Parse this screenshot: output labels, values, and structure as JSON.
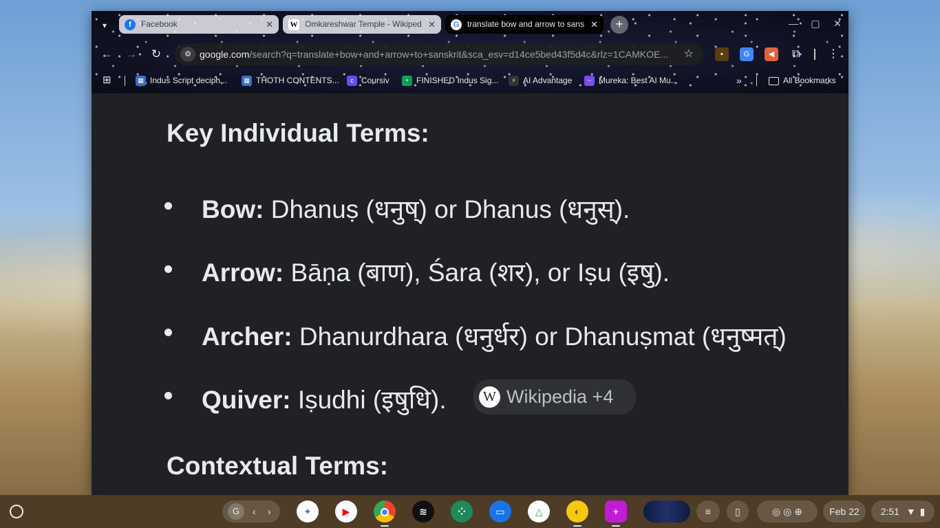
{
  "tabs": [
    {
      "title": "Facebook",
      "favicon": "facebook-icon",
      "active": false
    },
    {
      "title": "Omkareshwar Temple - Wikipedia",
      "favicon": "wikipedia-icon",
      "active": false
    },
    {
      "title": "translate bow and arrow to sanskrit",
      "favicon": "google-icon",
      "active": true
    }
  ],
  "toolbar": {
    "url_domain": "google.com",
    "url_path": "/search?q=translate+bow+and+arrow+to+sanskrit&sca_esv=d14ce5bed43f5d4c&rlz=1CAMKOE..."
  },
  "bookmarks": [
    {
      "label": "Indus Script deciph...",
      "icon": "sheets-grid-icon"
    },
    {
      "label": "THOTH CONTENTS...",
      "icon": "sheets-grid-icon"
    },
    {
      "label": "Coursiv",
      "icon": "coursiv-icon"
    },
    {
      "label": "FINISHED Indus Sig...",
      "icon": "sheets-plus-icon"
    },
    {
      "label": "AI Advantage",
      "icon": "ai-advantage-icon"
    },
    {
      "label": "Mureka: Best AI Mu...",
      "icon": "mureka-icon"
    }
  ],
  "all_bookmarks_label": "All Bookmarks",
  "content": {
    "heading1": "Key Individual Terms:",
    "items": [
      {
        "term": "Bow:",
        "text": " Dhanuṣ (धनुष्) or Dhanus (धनुस्)."
      },
      {
        "term": "Arrow:",
        "text": " Bāṇa (बाण), Śara (शर), or Iṣu (इषु)."
      },
      {
        "term": "Archer:",
        "text": " Dhanurdhara (धनुर्धर) or Dhanuṣmat (धनुष्मत्)"
      },
      {
        "term": "Quiver:",
        "text": " Iṣudhi (इषुधि)."
      }
    ],
    "source_chip": "Wikipedia +4",
    "heading2": "Contextual Terms:"
  },
  "shelf": {
    "pinned_label": "G",
    "date": "Feb 22",
    "time": "2:51"
  },
  "colors": {
    "page_bg": "#202124",
    "text": "#e8eaed",
    "chip_bg": "#303134"
  }
}
